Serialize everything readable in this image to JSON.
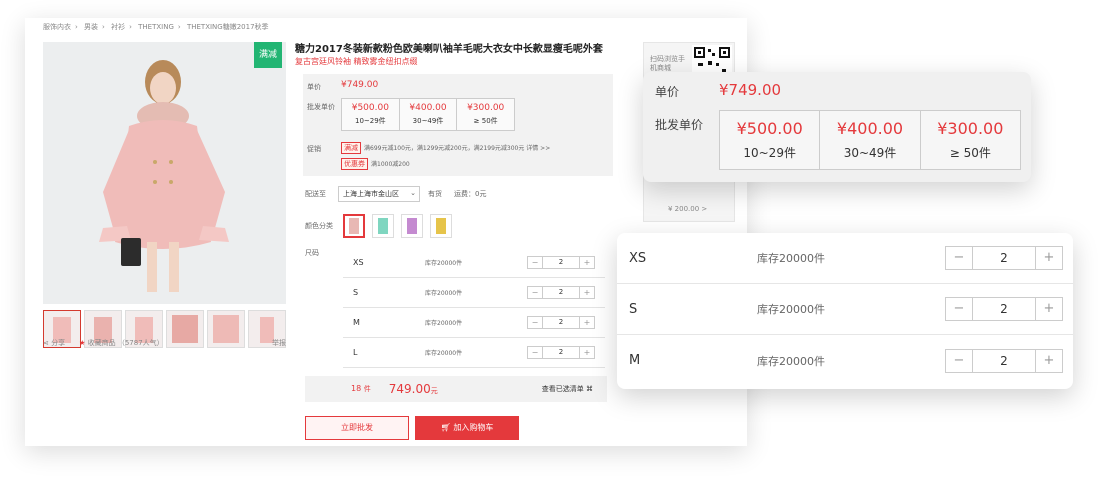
{
  "breadcrumb": [
    "服饰内衣",
    "男装",
    "衬衫",
    "THETXING",
    "THETXING糖嫩2017秋季"
  ],
  "product": {
    "badge": "满减",
    "title": "糖力2017冬装新款粉色欧美喇叭袖羊毛呢大衣女中长款显瘦毛呢外套",
    "promo_text": "复古宫廷风铃袖  精致雾金纽扣点缀"
  },
  "social": {
    "share": "分享",
    "favorite": "收藏商品 （5787人气）",
    "report": "举报"
  },
  "price": {
    "unit_label": "单价",
    "unit_value": "¥749.00",
    "batch_label": "批发单价",
    "tiers": [
      {
        "price": "¥500.00",
        "qty": "10~29件"
      },
      {
        "price": "¥400.00",
        "qty": "30~49件"
      },
      {
        "price": "¥300.00",
        "qty": "≥ 50件"
      }
    ],
    "promo_label": "促销",
    "promo_tag": "满减",
    "promo_detail": "满699元减100元，满1299元减200元，满2199元减300元  详情 >>",
    "coupon_tag": "优惠券",
    "coupon_detail": "满1000减200"
  },
  "shipping": {
    "label": "配送至",
    "location": "上海上海市金山区",
    "stock": "有货",
    "fee": "运费：0元"
  },
  "colors": {
    "label": "颜色分类",
    "swatches": [
      "#e8b8b4",
      "#7fd6c0",
      "#c48ad0",
      "#e6c44a"
    ]
  },
  "sizes": {
    "label": "尺码",
    "rows": [
      {
        "size": "XS",
        "stock": "库存20000件",
        "qty": "2"
      },
      {
        "size": "S",
        "stock": "库存20000件",
        "qty": "2"
      },
      {
        "size": "M",
        "stock": "库存20000件",
        "qty": "2"
      },
      {
        "size": "L",
        "stock": "库存20000件",
        "qty": "2"
      }
    ]
  },
  "summary": {
    "count": "18",
    "count_unit": "件",
    "total": "749.00",
    "total_unit": "元",
    "view": "查看已选清单"
  },
  "buttons": {
    "batch": "立即批发",
    "cart": "加入购物车"
  },
  "side": {
    "scan": "扫码浏览手机商城",
    "price": "¥ 200.00  >"
  },
  "zoom_price": {
    "unit_label": "单价",
    "unit_value": "¥749.00",
    "batch_label": "批发单价",
    "tiers": [
      {
        "price": "¥500.00",
        "qty": "10~29件"
      },
      {
        "price": "¥400.00",
        "qty": "30~49件"
      },
      {
        "price": "¥300.00",
        "qty": "≥ 50件"
      }
    ]
  },
  "zoom_sizes": [
    {
      "size": "XS",
      "stock": "库存20000件",
      "qty": "2"
    },
    {
      "size": "S",
      "stock": "库存20000件",
      "qty": "2"
    },
    {
      "size": "M",
      "stock": "库存20000件",
      "qty": "2"
    }
  ],
  "stepper": {
    "minus": "−",
    "plus": "+"
  },
  "colors_theme": {
    "accent": "#e4393c",
    "badge": "#22b573"
  }
}
